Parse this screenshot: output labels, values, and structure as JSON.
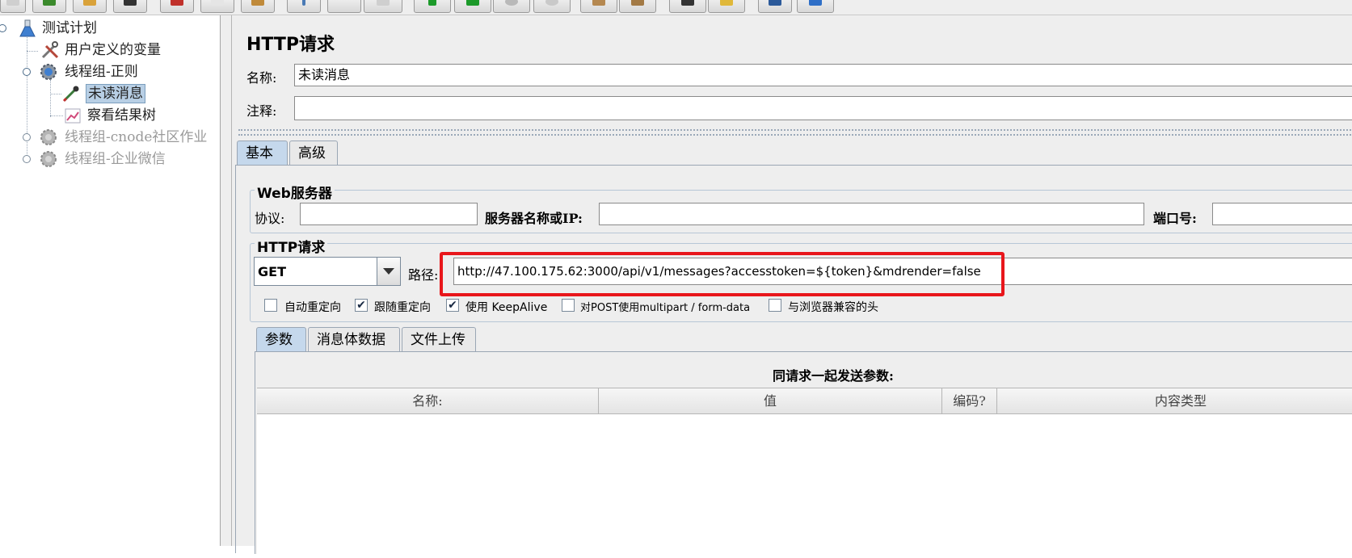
{
  "toolbar": {
    "buttons": [
      "new",
      "templates",
      "open",
      "save",
      "cut",
      "copy",
      "paste",
      "expand",
      "collapse",
      "toggle",
      "start",
      "start-no-pauses",
      "stop",
      "shutdown",
      "clear",
      "clear-all",
      "search",
      "reset-search",
      "function-helper",
      "help"
    ]
  },
  "tree": {
    "root": "测试计划",
    "items": [
      {
        "label": "用户定义的变量"
      },
      {
        "label": "线程组-正则"
      },
      {
        "label": "未读消息"
      },
      {
        "label": "察看结果树"
      },
      {
        "label": "线程组-cnode社区作业"
      },
      {
        "label": "线程组-企业微信"
      }
    ]
  },
  "panel": {
    "title": "HTTP请求",
    "name_label": "名称:",
    "name_value": "未读消息",
    "comment_label": "注释:",
    "comment_value": ""
  },
  "tabs": {
    "basic": "基本",
    "advanced": "高级"
  },
  "web_server": {
    "title": "Web服务器",
    "protocol_label": "协议:",
    "protocol_value": "",
    "server_label": "服务器名称或IP:",
    "server_value": "",
    "port_label": "端口号:",
    "port_value": ""
  },
  "http_request": {
    "title": "HTTP请求",
    "method": "GET",
    "path_label": "路径:",
    "path_value": "http://47.100.175.62:3000/api/v1/messages?accesstoken=${token}&mdrender=false",
    "options": [
      {
        "label": "自动重定向",
        "checked": false
      },
      {
        "label": "跟随重定向",
        "checked": true
      },
      {
        "label": "使用 KeepAlive",
        "checked": true
      },
      {
        "label": "对POST使用multipart / form-data",
        "checked": false
      },
      {
        "label": "与浏览器兼容的头",
        "checked": false
      }
    ]
  },
  "sub_tabs": {
    "params": "参数",
    "body": "消息体数据",
    "files": "文件上传"
  },
  "params": {
    "caption": "同请求一起发送参数:",
    "columns": [
      "名称:",
      "值",
      "编码?",
      "内容类型"
    ]
  },
  "colors": {
    "highlight_box": "#e8161b",
    "selection": "#b8cfe5",
    "tab_active": "#c5d8ec"
  }
}
